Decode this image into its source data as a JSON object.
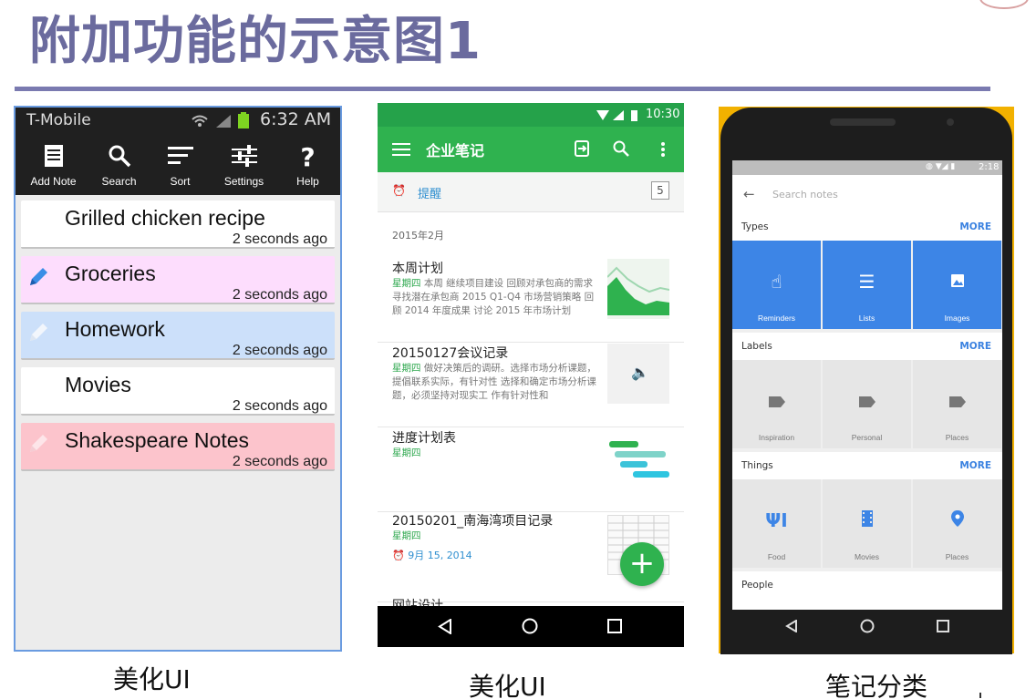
{
  "slide": {
    "title": "附加功能的示意图1",
    "captions": [
      "美化UI",
      "美化UI",
      "笔记分类"
    ]
  },
  "phone1": {
    "carrier": "T-Mobile",
    "time": "6:32 AM",
    "toolbar": [
      {
        "label": "Add Note",
        "icon": "note-icon"
      },
      {
        "label": "Search",
        "icon": "search-icon"
      },
      {
        "label": "Sort",
        "icon": "sort-icon"
      },
      {
        "label": "Settings",
        "icon": "settings-sliders-icon"
      },
      {
        "label": "Help",
        "icon": "help-icon"
      }
    ],
    "notes": [
      {
        "title": "Grilled chicken recipe",
        "time": "2 seconds ago",
        "color": "#ffffff"
      },
      {
        "title": "Groceries",
        "time": "2 seconds ago",
        "color": "#fdddfd"
      },
      {
        "title": "Homework",
        "time": "2 seconds ago",
        "color": "#cce0fa"
      },
      {
        "title": "Movies",
        "time": "2 seconds ago",
        "color": "#ffffff"
      },
      {
        "title": "Shakespeare Notes",
        "time": "2 seconds ago",
        "color": "#fcc4cc"
      }
    ]
  },
  "phone2": {
    "time": "10:30",
    "app_title": "企业笔记",
    "reminder_label": "提醒",
    "reminder_count": "5",
    "month": "2015年2月",
    "items": [
      {
        "title": "本周计划",
        "day": "星期四",
        "body": "本周 继续项目建设 回顾对承包商的需求 寻找潜在承包商 2015 Q1-Q4 市场营销策略 回顾 2014 年度成果 讨论 2015 年市场计划"
      },
      {
        "title": "20150127会议记录",
        "day": "星期四",
        "body": "做好决策后的调研。选择市场分析课题，提倡联系实际，有针对性 选择和确定市场分析课题，必须坚持对现实工 作有针对性和"
      },
      {
        "title": "进度计划表",
        "day": "星期四",
        "body": ""
      },
      {
        "title": "20150201_南海湾项目记录",
        "day": "星期四",
        "date": "9月 15, 2014"
      },
      {
        "title": "网站设计"
      }
    ],
    "accent": "#2fb24f"
  },
  "phone3": {
    "time": "2:18",
    "search_placeholder": "Search notes",
    "sections": [
      {
        "label": "Types",
        "more": "MORE",
        "tiles": [
          "Reminders",
          "Lists",
          "Images"
        ]
      },
      {
        "label": "Labels",
        "more": "MORE",
        "tiles": [
          "Inspiration",
          "Personal",
          "Places"
        ]
      },
      {
        "label": "Things",
        "more": "MORE",
        "tiles": [
          "Food",
          "Movies",
          "Places"
        ]
      },
      {
        "label": "People"
      }
    ],
    "accent": "#3d85e6"
  }
}
